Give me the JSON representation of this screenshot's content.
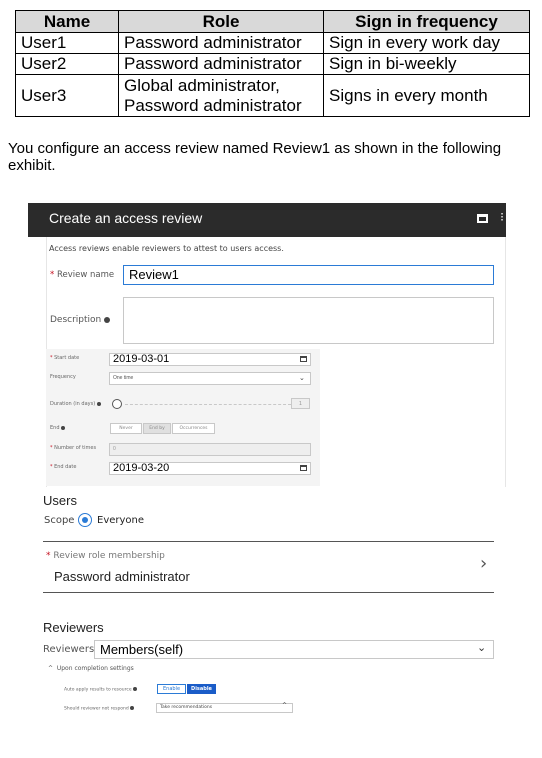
{
  "table": {
    "headers": [
      "Name",
      "Role",
      "Sign in frequency"
    ],
    "rows": [
      {
        "name": "User1",
        "role": [
          "Password administrator"
        ],
        "frequency": "Sign in every work day"
      },
      {
        "name": "User2",
        "role": [
          "Password administrator"
        ],
        "frequency": "Sign in bi-weekly"
      },
      {
        "name": "User3",
        "role": [
          "Global administrator,",
          "Password administrator"
        ],
        "frequency": "Signs in every month"
      }
    ]
  },
  "intro_text": "You configure an access review named Review1 as shown in the following exhibit.",
  "exhibit": {
    "title": "Create an access review",
    "subtitle": "Access reviews enable reviewers to attest to users access.",
    "review_name_label": "Review name",
    "review_name_value": "Review1",
    "description_label": "Description",
    "start_date_label": "Start date",
    "start_date_value": "2019-03-01",
    "frequency_label": "Frequency",
    "frequency_value": "One time",
    "duration_label": "Duration (in days)",
    "duration_value": "1",
    "end_label": "End",
    "end_options": [
      "Never",
      "End by",
      "Occurrences"
    ],
    "number_of_times_label": "Number of times",
    "number_of_times_value": "0",
    "end_date_label": "End date",
    "end_date_value": "2019-03-20",
    "users_heading": "Users",
    "scope_label": "Scope",
    "scope_value": "Everyone",
    "role_membership_label": "Review role membership",
    "role_membership_value": "Password administrator",
    "reviewers_heading": "Reviewers",
    "reviewers_label": "Reviewers",
    "reviewers_value": "Members(self)",
    "completion_settings_label": "Upon completion settings",
    "auto_apply_label": "Auto apply results to resource",
    "auto_apply_options": [
      "Enable",
      "Disable"
    ],
    "auto_apply_selected": "Disable",
    "not_respond_label": "Should reviewer not respond",
    "not_respond_value": "Take recommendations"
  }
}
